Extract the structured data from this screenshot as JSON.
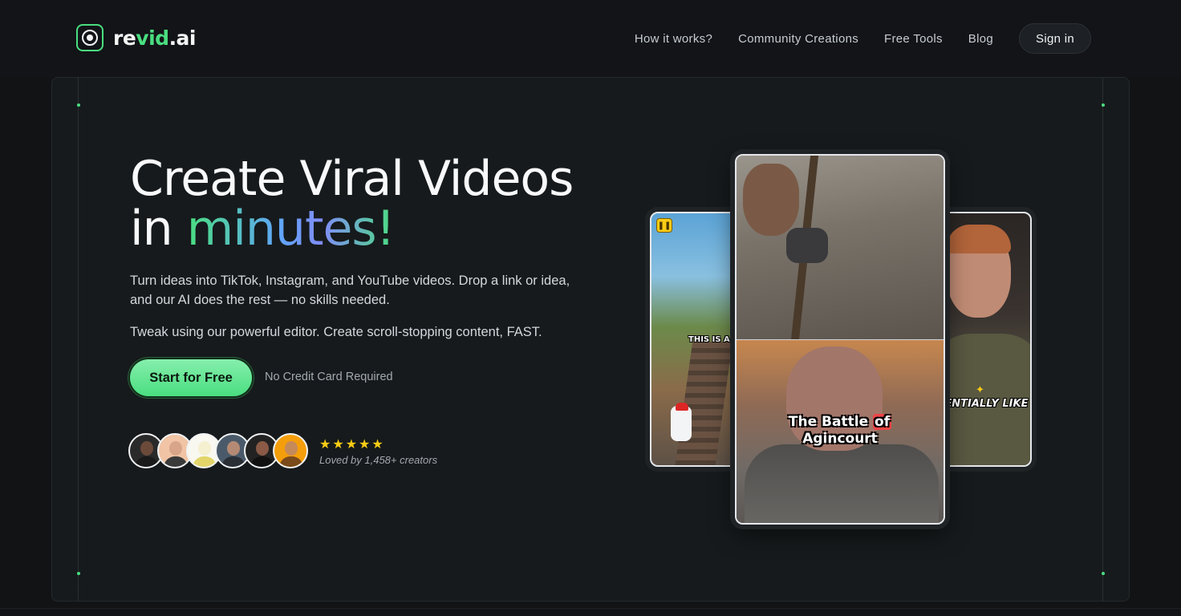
{
  "brand": {
    "name_prefix": "re",
    "name_highlight": "vid",
    "name_suffix": ".ai"
  },
  "nav": {
    "links": [
      "How it works?",
      "Community Creations",
      "Free Tools",
      "Blog"
    ],
    "signin_label": "Sign in"
  },
  "hero": {
    "headline_line1": "Create Viral Videos",
    "headline_in": "in ",
    "headline_highlight": "minutes!",
    "subtitle1": "Turn ideas into TikTok, Instagram, and YouTube videos. Drop a link or idea, and our AI does the rest — no skills needed.",
    "subtitle2": "Tweak using our powerful editor. Create scroll-stopping content, FAST.",
    "cta_label": "Start for Free",
    "no_credit_card": "No Credit Card Required",
    "rating_stars": "★★★★★",
    "rating": 5,
    "loved_by": "Loved by 1,458+ creators"
  },
  "videos": {
    "left_caption": "THIS IS A S",
    "center_caption_line1_pre": "The Battle ",
    "center_caption_line1_hl": "of",
    "center_caption_line2": "Agincourt",
    "right_caption": "SENTIALLY LIKE"
  },
  "colors": {
    "accent": "#4ade80",
    "background": "#111315",
    "panel": "#161a1c",
    "star": "#facc15"
  },
  "avatars": [
    {
      "skin": "#6b4a3a",
      "bg": "#2a2a2a",
      "shirt": "#1a1a1a"
    },
    {
      "skin": "#d9a58a",
      "bg": "#f0c4a4",
      "shirt": "#3a3a3a"
    },
    {
      "skin": "#f4f0d0",
      "bg": "#f8f8f0",
      "shirt": "#e2d66a"
    },
    {
      "skin": "#b58a74",
      "bg": "#4a5a6a",
      "shirt": "#2a2f36"
    },
    {
      "skin": "#8a5a46",
      "bg": "#222222",
      "shirt": "#111111"
    },
    {
      "skin": "#c58a5a",
      "bg": "#f59e0b",
      "shirt": "#7a4a1a"
    }
  ]
}
